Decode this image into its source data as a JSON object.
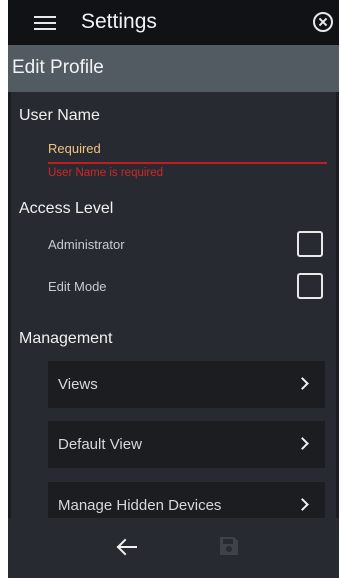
{
  "app": {
    "title": "Settings"
  },
  "page": {
    "title": "Edit Profile"
  },
  "user_name": {
    "label": "User Name",
    "value": "Required",
    "error": "User Name is required"
  },
  "access_level": {
    "label": "Access Level",
    "options": [
      {
        "label": "Administrator",
        "checked": false
      },
      {
        "label": "Edit Mode",
        "checked": false
      }
    ]
  },
  "management": {
    "label": "Management",
    "items": [
      {
        "label": "Views"
      },
      {
        "label": "Default View"
      },
      {
        "label": "Manage Hidden Devices"
      }
    ]
  },
  "colors": {
    "error": "#d52525",
    "input_text": "#f1c37d"
  },
  "icons": [
    "menu-icon",
    "close-icon",
    "chevron-right-icon",
    "back-arrow-icon",
    "save-icon"
  ]
}
